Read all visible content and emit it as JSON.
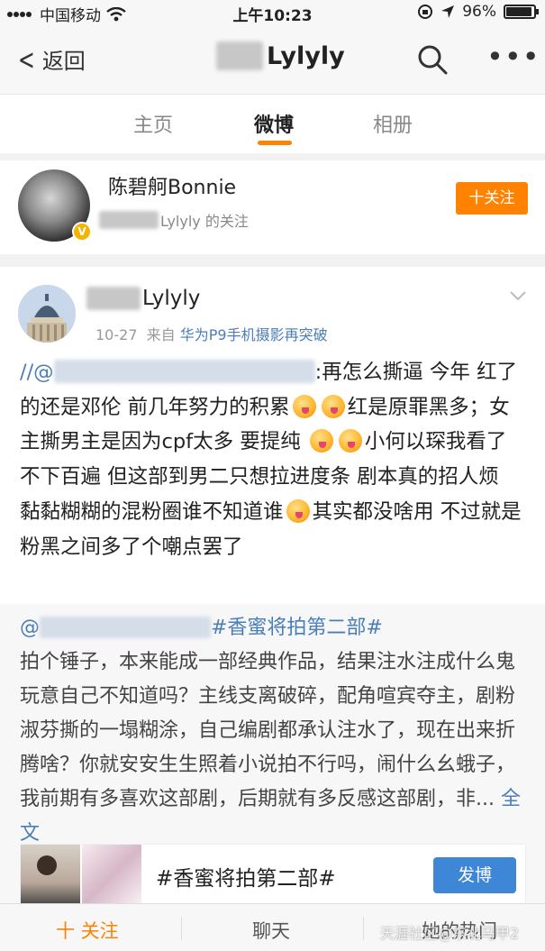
{
  "status_bar": {
    "carrier": "中国移动",
    "time": "上午10:23",
    "battery": "96%",
    "icons": [
      "signal-icon",
      "wifi-icon",
      "lock-rotation-icon",
      "location-icon",
      "battery-icon"
    ]
  },
  "nav": {
    "back_label": "返回",
    "title_suffix": "Lylyly",
    "icons": [
      "back-chevron-icon",
      "search-icon",
      "more-icon"
    ]
  },
  "tabs": [
    {
      "label": "主页",
      "active": false
    },
    {
      "label": "微博",
      "active": true
    },
    {
      "label": "相册",
      "active": false
    }
  ],
  "follow_card": {
    "name": "陈碧舸Bonnie",
    "sub_suffix": "Lylyly 的关注",
    "follow_button": "十关注"
  },
  "post": {
    "author_suffix": "Lylyly",
    "date": "10-27",
    "source_prefix": "来自",
    "source": "华为P9手机摄影再突破",
    "text_prefix": "//@",
    "text_line1": ":再怎么撕逼 今年",
    "text_part2": "红了的还是邓伦 前几年努力的积累",
    "text_part3": "红是原罪黑多；女主撕男主是因为cpf太多 要提纯",
    "text_part4": "小何以琛我看了不下百遍 但这部到男二只想拉进度条 剧本真的招人烦 黏黏糊糊的混粉圈谁不知道谁",
    "text_part5": "其实都没啥用 不过就是粉黑之间多了个嘲点罢了"
  },
  "repost": {
    "mention_prefix": "@",
    "topic": "#香蜜将拍第二部#",
    "body": "拍个锤子，本来能成一部经典作品，结果注水注成什么鬼玩意自己不知道吗？主线支离破碎，配角喧宾夺主，剧粉淑芬撕的一塌糊涂，自己编剧都承认注水了，现在出来折腾啥？你就安安生生照着小说拍不行吗，闹什么幺蛾子，我前期有多喜欢这部剧，后期就有多反感这部剧，非...",
    "full_text": "全文"
  },
  "topic_card": {
    "title": "#香蜜将拍第二部#",
    "button": "发博"
  },
  "bottom_bar": {
    "follow": "十 关注",
    "chat": "聊天",
    "hot": "她的热门"
  },
  "watermark": "天涯社区@东北马甲2",
  "colors": {
    "accent": "#ff8200",
    "link": "#4a7eb8",
    "post_button": "#3e86d6"
  }
}
